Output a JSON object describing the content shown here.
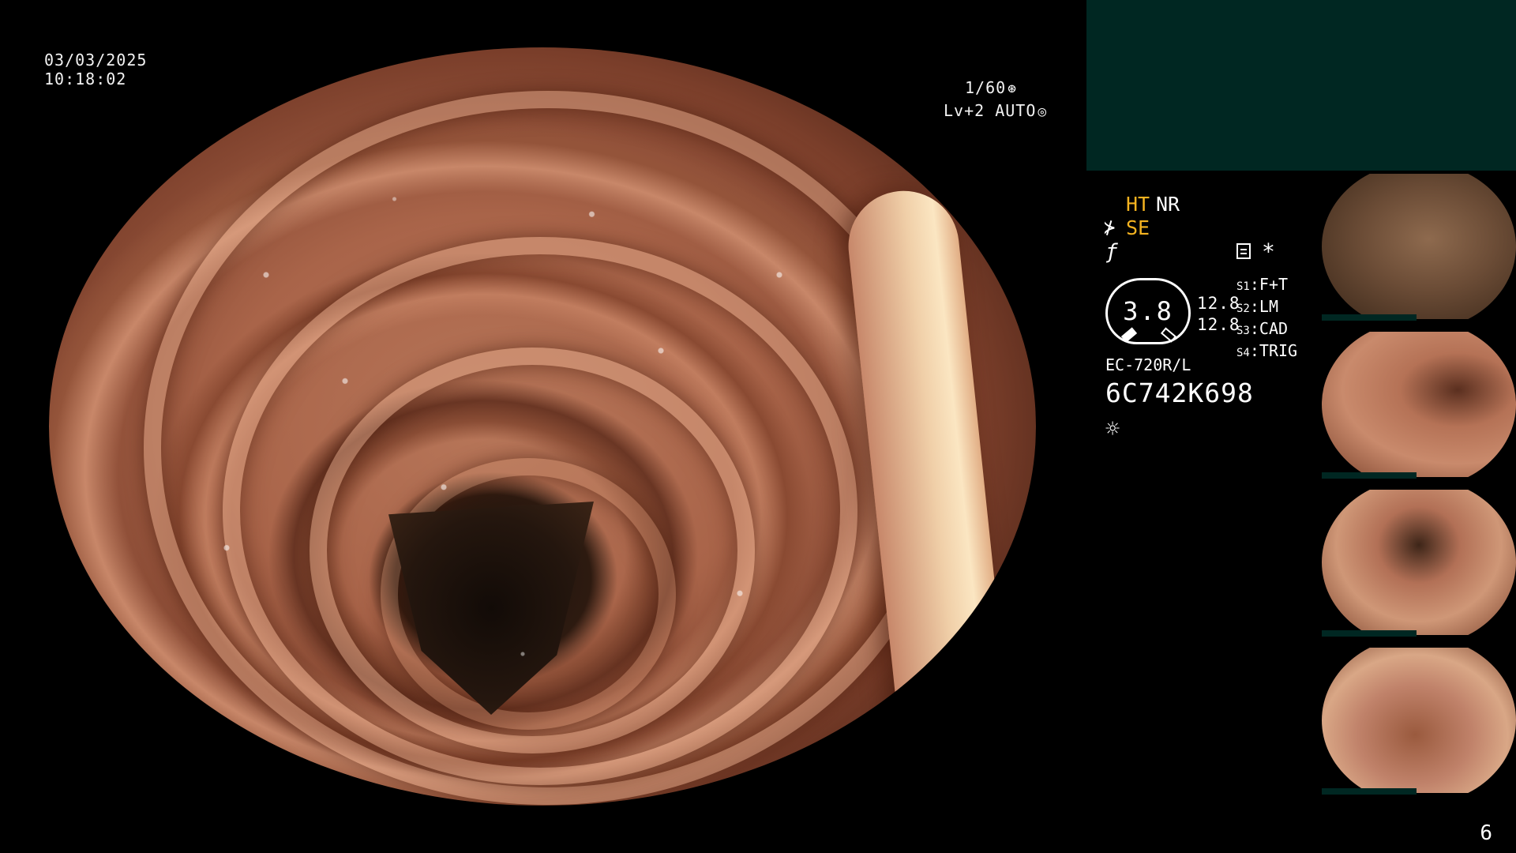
{
  "osd": {
    "date": "03/03/2025",
    "time": "10:18:02",
    "shutter": "1/60",
    "shutter_icon": "⊛",
    "level": "Lv+2 AUTO",
    "level_icon": "◎"
  },
  "info": {
    "ht": "HT",
    "nr": "NR",
    "se_icon": "⊁",
    "se": "SE",
    "f_icon": "ƒ",
    "asterisk": "*",
    "dial_value": "3.8",
    "val1": "12.8",
    "val2": "12.8",
    "switches": [
      {
        "key": "S1",
        "label": "F+T"
      },
      {
        "key": "S2",
        "label": "LM"
      },
      {
        "key": "S3",
        "label": "CAD"
      },
      {
        "key": "S4",
        "label": "TRIG"
      }
    ],
    "model": "EC-720R/L",
    "serial": "6C742K698",
    "sun_icon": "☼"
  },
  "page_number": "6",
  "colors": {
    "accent_yellow": "#f5b320",
    "panel_teal": "#002722",
    "background": "#000000"
  }
}
